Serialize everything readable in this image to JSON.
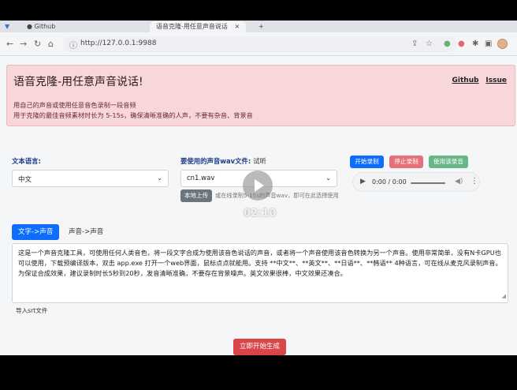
{
  "browser": {
    "tab1_label": "Github",
    "tab2_label": "语音克隆-用任意声音说话",
    "new_tab_icon": "plus-icon",
    "address": "http://127.0.0.1:9988"
  },
  "header": {
    "title": "语音克隆-用任意声音说话!",
    "link_github": "Github",
    "link_issue": "Issue",
    "desc_line1": "用自己的声音或使用任意音色录制一段音频",
    "desc_line2": "用于克隆的最佳音频素材时长为 5-15s，确保清晰准确的人声，不要有杂音、背景音"
  },
  "form": {
    "lang_label": "文本语言:",
    "lang_value": "中文",
    "voice_label": "要使用的声音wav文件:",
    "voice_sub": "试听",
    "voice_value": "cn1.wav",
    "upload_button": "本地上传",
    "upload_hint": "或在线录制5-15s的声音wav，即可在此选择使用",
    "start_record": "开始录制",
    "stop_record": "停止录制",
    "use_record": "使用该录音",
    "audio_time": "0:00 / 0:00"
  },
  "tabs": {
    "text_to_speech": "文字->声音",
    "speech_to_speech": "声音->声音"
  },
  "content": {
    "text": "这是一个声音克隆工具，可使用任何人类音色，将一段文字合成为使用该音色说话的声音，或者将一个声音使用该音色转换为另一个声音。使用非常简单，没有N卡GPU也可以使用，下载预编译版本，双击 app.exe 打开一个web界面，鼠标点点就能用。支持 **中文**、**英文**、**日语**、**韩语** 4种语言，可在线从麦克风录制声音。为保证合成效果，建议录制时长5秒到20秒，发音清晰准确，不要存在背景噪声。英文效果很棒，中文效果还凑合。",
    "srt_label": "导入srt文件",
    "generate_button": "立即开始生成"
  },
  "video": {
    "time": "02:10"
  }
}
